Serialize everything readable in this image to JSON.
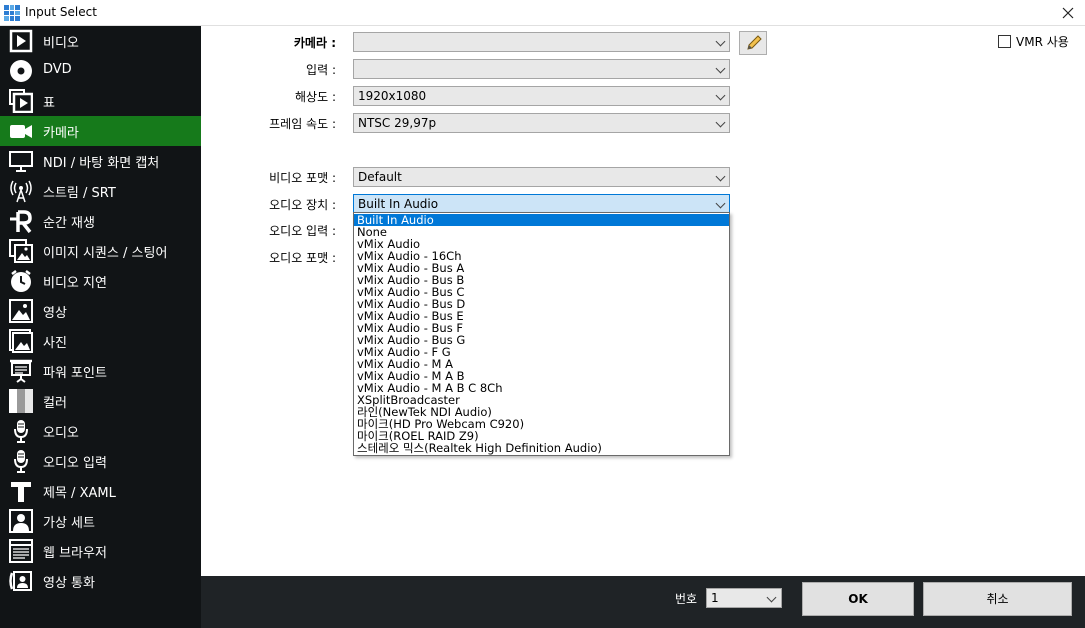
{
  "window": {
    "title": "Input Select"
  },
  "sidebar": {
    "items": [
      {
        "label": "비디오",
        "icon": "video-icon"
      },
      {
        "label": "DVD",
        "icon": "disc-icon"
      },
      {
        "label": "표",
        "icon": "list-icon"
      },
      {
        "label": "카메라",
        "icon": "camera-icon",
        "active": true
      },
      {
        "label": "NDI / 바탕 화면 캡처",
        "icon": "monitor-icon"
      },
      {
        "label": "스트림 / SRT",
        "icon": "antenna-icon"
      },
      {
        "label": "순간 재생",
        "icon": "replay-icon"
      },
      {
        "label": "이미지 시퀀스 / 스팅어",
        "icon": "image-sequence-icon"
      },
      {
        "label": "비디오 지연",
        "icon": "clock-icon"
      },
      {
        "label": "영상",
        "icon": "picture-icon"
      },
      {
        "label": "사진",
        "icon": "photos-icon"
      },
      {
        "label": "파워 포인트",
        "icon": "presentation-icon"
      },
      {
        "label": "컬러",
        "icon": "color-bars-icon"
      },
      {
        "label": "오디오",
        "icon": "microphone-icon"
      },
      {
        "label": "오디오 입력",
        "icon": "microphone-input-icon"
      },
      {
        "label": "제목 / XAML",
        "icon": "title-t-icon"
      },
      {
        "label": "가상 세트",
        "icon": "virtual-set-icon"
      },
      {
        "label": "웹 브라우저",
        "icon": "web-browser-icon"
      },
      {
        "label": "영상 통화",
        "icon": "video-call-icon"
      }
    ]
  },
  "form": {
    "camera_label": "카메라 :",
    "camera_value": "",
    "input_label": "입력 :",
    "input_value": "",
    "resolution_label": "해상도 :",
    "resolution_value": "1920x1080",
    "framerate_label": "프레임 속도 :",
    "framerate_value": "NTSC 29,97p",
    "video_format_label": "비디오 포맷 :",
    "video_format_value": "Default",
    "audio_device_label": "오디오 장치 :",
    "audio_device_value": "Built In Audio",
    "audio_input_label": "오디오 입력 :",
    "audio_format_label": "오디오 포맷 :",
    "vmr_label": "VMR 사용",
    "vmr_checked": false
  },
  "audio_dropdown": {
    "options": [
      "Built In Audio",
      "None",
      "vMix Audio",
      "vMix Audio - 16Ch",
      "vMix Audio - Bus A",
      "vMix Audio - Bus B",
      "vMix Audio - Bus C",
      "vMix Audio - Bus D",
      "vMix Audio - Bus E",
      "vMix Audio - Bus F",
      "vMix Audio - Bus G",
      "vMix Audio - F G",
      "vMix Audio - M A",
      "vMix Audio - M A B",
      "vMix Audio - M A B C 8Ch",
      "XSplitBroadcaster",
      "라인(NewTek NDI Audio)",
      "마이크(HD Pro Webcam C920)",
      "마이크(ROEL RAID Z9)",
      "스테레오 믹스(Realtek High Definition Audio)"
    ],
    "selected_index": 0
  },
  "footer": {
    "number_label": "번호",
    "number_value": "1",
    "ok_label": "OK",
    "cancel_label": "취소"
  },
  "colors": {
    "sidebar_bg": "#111416",
    "sidebar_active": "#167a1b",
    "footer_bg": "#1f2326",
    "selection": "#0078d7"
  }
}
